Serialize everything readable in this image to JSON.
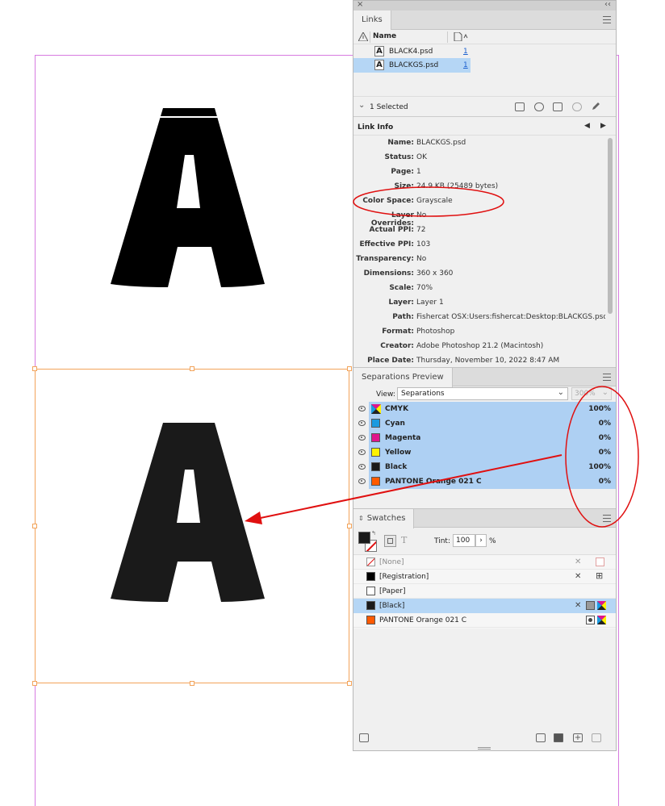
{
  "canvas": {
    "letter": "A"
  },
  "links_panel": {
    "tab_label": "Links",
    "col_name": "Name",
    "items": [
      {
        "icon": "A",
        "name": "BLACK4.psd",
        "page": "1"
      },
      {
        "icon": "A",
        "name": "BLACKGS.psd",
        "page": "1"
      }
    ],
    "selected_count": "1 Selected"
  },
  "link_info": {
    "title": "Link Info",
    "rows": [
      {
        "label": "Name:",
        "value": "BLACKGS.psd"
      },
      {
        "label": "Status:",
        "value": "OK"
      },
      {
        "label": "Page:",
        "value": "1"
      },
      {
        "label": "Size:",
        "value": "24.9 KB (25489 bytes)"
      },
      {
        "label": "Color Space:",
        "value": "Grayscale"
      },
      {
        "label": "Layer Overrides:",
        "value": "No"
      },
      {
        "label": "Actual PPI:",
        "value": "72"
      },
      {
        "label": "Effective PPI:",
        "value": "103"
      },
      {
        "label": "Transparency:",
        "value": "No"
      },
      {
        "label": "Dimensions:",
        "value": "360 x 360"
      },
      {
        "label": "Scale:",
        "value": "70%"
      },
      {
        "label": "Layer:",
        "value": "Layer 1"
      },
      {
        "label": "Path:",
        "value": "Fishercat OSX:Users:fishercat:Desktop:BLACKGS.psd"
      },
      {
        "label": "Format:",
        "value": "Photoshop"
      },
      {
        "label": "Creator:",
        "value": "Adobe Photoshop 21.2 (Macintosh)"
      },
      {
        "label": "Place Date:",
        "value": "Thursday, November 10, 2022 8:47 AM"
      }
    ]
  },
  "separations": {
    "tab_label": "Separations Preview",
    "view_label": "View:",
    "view_value": "Separations",
    "zoom_value": "300%",
    "inks": [
      {
        "name": "CMYK",
        "value": "100%",
        "color": "cmyk"
      },
      {
        "name": "Cyan",
        "value": "0%",
        "color": "#1a9ae0"
      },
      {
        "name": "Magenta",
        "value": "0%",
        "color": "#e0148c"
      },
      {
        "name": "Yellow",
        "value": "0%",
        "color": "#fff200"
      },
      {
        "name": "Black",
        "value": "100%",
        "color": "#1a1a1a"
      },
      {
        "name": "PANTONE Orange 021 C",
        "value": "0%",
        "color": "#ff5a00"
      }
    ]
  },
  "swatches": {
    "tab_label": "Swatches",
    "tint_label": "Tint:",
    "tint_value": "100",
    "percent": "%",
    "items": [
      {
        "name": "[None]",
        "color": "none"
      },
      {
        "name": "[Registration]",
        "color": "#000000"
      },
      {
        "name": "[Paper]",
        "color": "#ffffff"
      },
      {
        "name": "[Black]",
        "color": "#1a1a1a"
      },
      {
        "name": "PANTONE Orange 021 C",
        "color": "#ff5a00"
      }
    ]
  },
  "colors": {
    "annotation": "#e01010",
    "selection": "#b5d6f5",
    "frame": "#f2a35a",
    "guide": "#d77be0"
  }
}
